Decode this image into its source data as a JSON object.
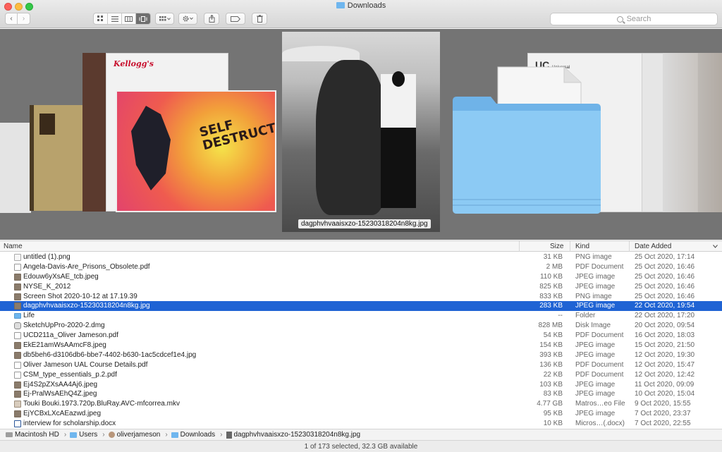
{
  "window": {
    "title": "Downloads"
  },
  "toolbar": {
    "back": "‹",
    "forward": "›",
    "search_placeholder": "Search"
  },
  "coverflow": {
    "caption": "dagphvhvaaisxzo-15230318204n8kg.jpg",
    "cereal_brand": "Kellogg's",
    "art_text_1": "SELF",
    "art_text_2": "DESTRUCT!",
    "letterhead": "UC",
    "letterhead_sub": "Universal"
  },
  "columns": {
    "name": "Name",
    "size": "Size",
    "kind": "Kind",
    "date": "Date Added"
  },
  "files": [
    {
      "name": "untitled (1).png",
      "size": "31 KB",
      "kind": "PNG image",
      "date": "25 Oct 2020, 17:14",
      "icon": "png"
    },
    {
      "name": "Angela-Davis-Are_Prisons_Obsolete.pdf",
      "size": "2 MB",
      "kind": "PDF Document",
      "date": "25 Oct 2020, 16:46",
      "icon": "pdf"
    },
    {
      "name": "Edouw6yXsAE_tcb.jpeg",
      "size": "110 KB",
      "kind": "JPEG image",
      "date": "25 Oct 2020, 16:46",
      "icon": "img"
    },
    {
      "name": "NYSE_K_2012",
      "size": "825 KB",
      "kind": "JPEG image",
      "date": "25 Oct 2020, 16:46",
      "icon": "img"
    },
    {
      "name": "Screen Shot 2020-10-12 at 17.19.39",
      "size": "833 KB",
      "kind": "PNG image",
      "date": "25 Oct 2020, 16:46",
      "icon": "img"
    },
    {
      "name": "dagphvhvaaisxzo-15230318204n8kg.jpg",
      "size": "283 KB",
      "kind": "JPEG image",
      "date": "22 Oct 2020, 19:54",
      "icon": "img",
      "selected": true
    },
    {
      "name": "Life",
      "size": "--",
      "kind": "Folder",
      "date": "22 Oct 2020, 17:20",
      "icon": "folder"
    },
    {
      "name": "SketchUpPro-2020-2.dmg",
      "size": "828 MB",
      "kind": "Disk Image",
      "date": "20 Oct 2020, 09:54",
      "icon": "dmg"
    },
    {
      "name": "UCD211a_Oliver Jameson.pdf",
      "size": "54 KB",
      "kind": "PDF Document",
      "date": "16 Oct 2020, 18:03",
      "icon": "pdf"
    },
    {
      "name": "EkE21amWsAAmcF8.jpeg",
      "size": "154 KB",
      "kind": "JPEG image",
      "date": "15 Oct 2020, 21:50",
      "icon": "img"
    },
    {
      "name": "db5beh6-d3106db6-bbe7-4402-b630-1ac5cdcef1e4.jpg",
      "size": "393 KB",
      "kind": "JPEG image",
      "date": "12 Oct 2020, 19:30",
      "icon": "img"
    },
    {
      "name": "Oliver Jameson UAL Course Details.pdf",
      "size": "136 KB",
      "kind": "PDF Document",
      "date": "12 Oct 2020, 15:47",
      "icon": "pdf"
    },
    {
      "name": "CSM_type_essentials_p.2.pdf",
      "size": "22 KB",
      "kind": "PDF Document",
      "date": "12 Oct 2020, 12:42",
      "icon": "pdf"
    },
    {
      "name": "Ej4S2pZXsAA4Aj6.jpeg",
      "size": "103 KB",
      "kind": "JPEG image",
      "date": "11 Oct 2020, 09:09",
      "icon": "img"
    },
    {
      "name": "Ej-PralWsAEhQ4Z.jpeg",
      "size": "83 KB",
      "kind": "JPEG image",
      "date": "10 Oct 2020, 15:04",
      "icon": "img"
    },
    {
      "name": "Touki Bouki.1973.720p.BluRay.AVC-mfcorrea.mkv",
      "size": "4.77 GB",
      "kind": "Matros…eo File",
      "date": "9 Oct 2020, 15:55",
      "icon": "mkv"
    },
    {
      "name": "EjYCBxLXcAEazwd.jpeg",
      "size": "95 KB",
      "kind": "JPEG image",
      "date": "7 Oct 2020, 23:37",
      "icon": "img"
    },
    {
      "name": "interview for scholarship.docx",
      "size": "10 KB",
      "kind": "Micros…(.docx)",
      "date": "7 Oct 2020, 22:55",
      "icon": "docx"
    }
  ],
  "path": [
    "Macintosh HD",
    "Users",
    "oliverjameson",
    "Downloads",
    "dagphvhvaaisxzo-15230318204n8kg.jpg"
  ],
  "status": "1 of 173 selected, 32.3 GB available"
}
